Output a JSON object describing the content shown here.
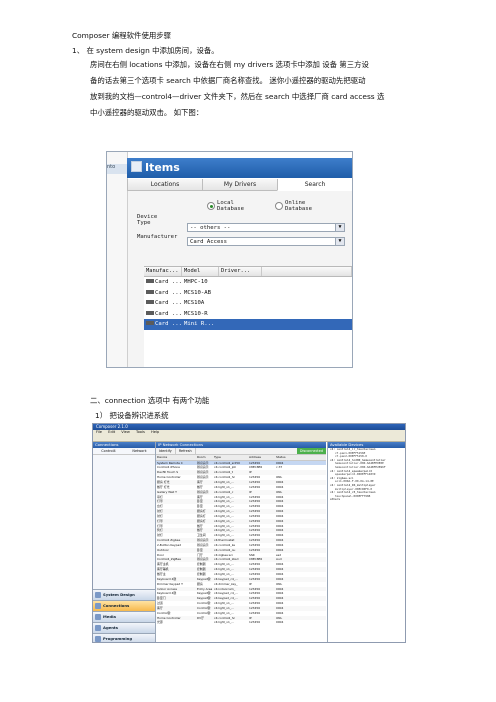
{
  "doc": {
    "title": "Composer 编程软件使用步骤",
    "step1": "1、 在 system design 中添加房间，设备。",
    "body_lines": [
      "房间在右侧 locations 中添加，设备在右侧 my drivers 选项卡中添加 设备     第三方设",
      "备的话去第三个选项卡   search 中依据厂商名称查找。 迷你小遥控器的驱动先把驱动",
      "放到我的文档—control4—driver 文件夹下，然后在 search   中选择厂商 card access   选",
      "中小遥控器的驱动双击。    如下图："
    ],
    "section2": "二、connection  选项中  有两个功能",
    "section2_item1": "1）  把设备辨识进系统"
  },
  "shot1": {
    "left_tab": "nto",
    "header": "Items",
    "tabs": [
      "Locations",
      "My Drivers",
      "Search"
    ],
    "radio_local": "Local\nDatabase",
    "radio_online": "Online\nDatabase",
    "device_type_label": "Device\nType",
    "device_type_value": "-- others --",
    "manufacturer_label": "Manufacturer",
    "manufacturer_value": "Card Access",
    "columns": [
      "Manufac...",
      "Model",
      "Driver...",
      ""
    ],
    "rows": [
      {
        "manu": "Card ...",
        "model": "MHPC-10",
        "sel": false
      },
      {
        "manu": "Card ...",
        "model": "MCS10-AB",
        "sel": false
      },
      {
        "manu": "Card ...",
        "model": "MCS10A",
        "sel": false
      },
      {
        "manu": "Card ...",
        "model": "MCS10-R",
        "sel": false
      },
      {
        "manu": "Card ...",
        "model": "Mini R...",
        "sel": true
      }
    ]
  },
  "shot2": {
    "window_title": "Composer 2.1.0",
    "menu": [
      "File",
      "Edit",
      "View",
      "Tools",
      "Help"
    ],
    "left_header": "Connections",
    "left_tabs": [
      "Control4",
      "Network"
    ],
    "nav": [
      "System Design",
      "Connections",
      "Media",
      "Agents",
      "Programming"
    ],
    "mid_header": "IP Network Connections",
    "mid_tabs": [
      "Identify",
      "Refresh",
      "Disconnected"
    ],
    "columns": [
      "Device",
      "Room",
      "Type",
      "Address",
      "Status"
    ],
    "rows": [
      [
        "System Remote C",
        "辨识演示",
        "c4:control4_sr250",
        "123456",
        "0004"
      ],
      [
        "Control4 iPhone",
        "辨识演示",
        "c4:control4_iph",
        "C8EC8E6",
        "c:37"
      ],
      [
        "Devfill Touch S",
        "辨识演示",
        "c4:control4_t",
        "IP",
        ""
      ],
      [
        "Home Controller",
        "辨识演示",
        "c4:control4_hc",
        "123456",
        "ONL"
      ],
      [
        "厨房  灯光",
        "客厅",
        "c4:light_v1_...",
        "123456",
        "0004"
      ],
      [
        "餐厅  灯光",
        "餐厅",
        "c4:light_v1_...",
        "123456",
        "0004"
      ],
      [
        "Gallery Wall T",
        "辨识演示",
        "c4:control4_c",
        "IP",
        "ONL"
      ],
      [
        "吊灯   ",
        "客厅",
        "c4:light_v1_...",
        "123456",
        "0004"
      ],
      [
        "灯带   ",
        "卧室",
        "c4:light_v1_...",
        "123456",
        "0004"
      ],
      [
        "台灯   ",
        "卧室",
        "c4:light_v1_...",
        "123456",
        "0004"
      ],
      [
        "射灯   ",
        "厨房灯",
        "c4:light_v1_...",
        "123456",
        "0004"
      ],
      [
        "射灯   ",
        "厨房灯",
        "c4:light_v1_...",
        "123456",
        "0004"
      ],
      [
        "灯带   ",
        "厨房灯",
        "c4:light_v1_...",
        "123456",
        "0004"
      ],
      [
        "灯带   ",
        "餐厅",
        "c4:light_v1_...",
        "123456",
        "0004"
      ],
      [
        "筒灯   ",
        "餐厅",
        "c4:light_v1_...",
        "123456",
        "0004"
      ],
      [
        "射灯   ",
        "卫生间",
        "c4:light_v1_...",
        "123456",
        "0004"
      ],
      [
        "Control4 Zigbee",
        "辨识演示",
        "c4:thermostat",
        "123456",
        "0004"
      ],
      [
        "2-Button Keypad",
        "辨识演示",
        "c4:control4_ke",
        "123456",
        "0004"
      ],
      [
        "Outdoor",
        "卧室",
        "c4:control4_ou",
        "123456",
        "0004"
      ],
      [
        "Door",
        "门厅",
        "c4:zigbee:sci",
        "SSR",
        "esd"
      ],
      [
        "Control4_ZigBee",
        "辨识演示",
        "c4:control4_zbsd",
        "C8EC8E6",
        "Aud"
      ],
      [
        "客厅主机",
        "控制器",
        "c4:light_v1_...",
        "123456",
        "0004"
      ],
      [
        "客厅辅机",
        "控制器",
        "c4:light_v1_...",
        "123456",
        "0004"
      ],
      [
        "餐厅主",
        "控制器",
        "c4:light_v1_...",
        "123456",
        "0004"
      ],
      [
        "Keyboard 4键",
        "Keypad键",
        "c4:keypad_c4_...",
        "123456",
        "0004"
      ],
      [
        "Dimmer Keypad T",
        "厨房",
        "c4:dimmer_key_",
        "IP",
        "ONL"
      ],
      [
        "Indoor Access",
        "Entry Area",
        "c4:indoorcam_",
        "123456",
        "0004"
      ],
      [
        "Keyboard 4键",
        "Keypad键",
        "c4:keypad_c4_...",
        "123456",
        "0004"
      ],
      [
        "卧室门",
        "Keypad键",
        "c4:keypad_c4_...",
        "123456",
        "0004"
      ],
      [
        "过道",
        "Control键",
        "c4:light_v1_...",
        "123456",
        "0004"
      ],
      [
        "客厅",
        "Control键",
        "c4:light_v1_...",
        "123456",
        "0004"
      ],
      [
        "Control键",
        "Control键",
        "c4:light_v1_...",
        "123456",
        "0004"
      ],
      [
        "Home Controller",
        "DV厅",
        "c4:control4_hc",
        "IP",
        "ONL"
      ],
      [
        "光源",
        "",
        "c4:light_v1_...",
        "123456",
        "0004"
      ]
    ],
    "right_header": "Available Devices",
    "right_items": [
      {
        "t": "c4: control4_ir_touchscreen",
        "i": false
      },
      {
        "t": "c7-pan1-00EFF5156E",
        "i": true
      },
      {
        "t": "c7-pan2-00EFF5158-0",
        "i": true
      },
      {
        "t": "c4: control4_hc200_homecontroller",
        "i": false
      },
      {
        "t": "homecontroller-000-6A4BFE0E0E",
        "i": true
      },
      {
        "t": "homecontroller-000-6A4BFE2896F",
        "i": true
      },
      {
        "t": "c4: control4_speakerpoint",
        "i": false
      },
      {
        "t": "speakerpoint-000EFF14839",
        "i": true
      },
      {
        "t": "c4: zigbee.sci",
        "i": false
      },
      {
        "t": "sci1-000A-F-00-0A-14-8E",
        "i": true
      },
      {
        "t": "c4: control4_IR_multiplayer",
        "i": false
      },
      {
        "t": "multiplayer-00ECD0F0-0",
        "i": true
      },
      {
        "t": "c4: control4_c5_touchscreen",
        "i": false
      },
      {
        "t": "touchpanel-000EFF7988",
        "i": true
      },
      {
        "t": "others",
        "i": false
      }
    ]
  }
}
